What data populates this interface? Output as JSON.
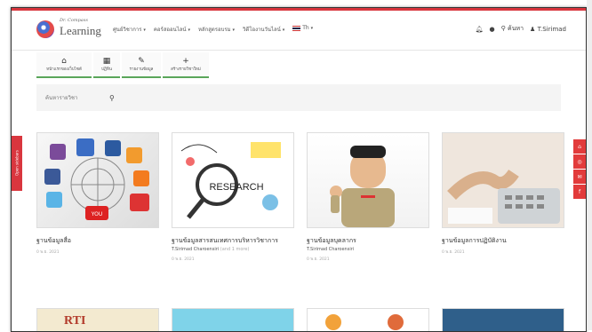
{
  "brand": {
    "line1": "Dr. Compass",
    "line2": "Learning"
  },
  "menu": [
    {
      "label": "ศูนย์วิชาการ"
    },
    {
      "label": "คอร์สออนไลน์"
    },
    {
      "label": "หลักสูตรอบรม"
    },
    {
      "label": "วิดีโองานวันไลน์"
    },
    {
      "label": "Th"
    }
  ],
  "right_nav": {
    "search_label": "ค้นหา",
    "user_label": "T.Sirimad"
  },
  "toolbar": [
    {
      "icon": "home-icon",
      "glyph": "⌂",
      "label": "หน้าแรกของเว็บไซต์"
    },
    {
      "icon": "calendar-icon",
      "glyph": "▦",
      "label": "ปฏิทิน"
    },
    {
      "icon": "report-icon",
      "glyph": "✎",
      "label": "รายงานข้อมูล"
    },
    {
      "icon": "plus-icon",
      "glyph": "+",
      "label": "สร้างรายวิชาใหม่"
    }
  ],
  "search": {
    "placeholder": "ค้นหารายวิชา"
  },
  "side_tab": {
    "label": "Open sidebars"
  },
  "cards": [
    {
      "title": "ฐานข้อมูลสื่อ",
      "author": "",
      "author_note": "",
      "meta": "0  พ.ย. 2021",
      "tag": "YOU"
    },
    {
      "title": "ฐานข้อมูลสารสนเทศการบริหารวิชาการ",
      "author": "T.Sirimad Charoensiri",
      "author_note": "(and 1 more)",
      "meta": "0  พ.ย. 2021",
      "tag": "RESEARCH"
    },
    {
      "title": "ฐานข้อมูลบุคลากร",
      "author": "T.Sirimad Charoensiri",
      "author_note": "",
      "meta": "0  พ.ย. 2021",
      "tag": ""
    },
    {
      "title": "ฐานข้อมูลการปฏิบัติงาน",
      "author": "",
      "author_note": "",
      "meta": "0  พ.ย. 2021",
      "tag": ""
    }
  ],
  "bottom_card_tag": "RTI",
  "colors": {
    "accent": "#d9363e",
    "toolbar_underline": "#5aa65a"
  }
}
